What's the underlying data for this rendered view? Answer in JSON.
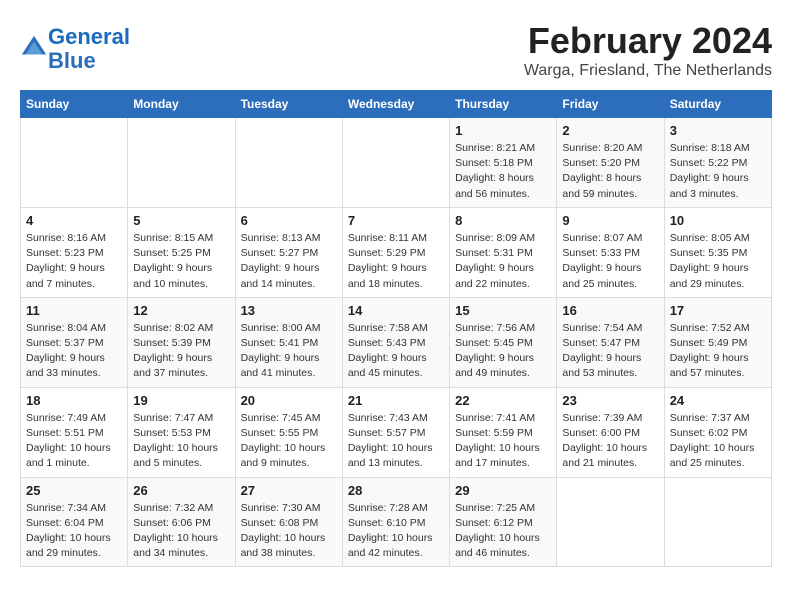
{
  "header": {
    "logo_line1": "General",
    "logo_line2": "Blue",
    "title": "February 2024",
    "subtitle": "Warga, Friesland, The Netherlands"
  },
  "days_of_week": [
    "Sunday",
    "Monday",
    "Tuesday",
    "Wednesday",
    "Thursday",
    "Friday",
    "Saturday"
  ],
  "weeks": [
    [
      {
        "day": "",
        "info": ""
      },
      {
        "day": "",
        "info": ""
      },
      {
        "day": "",
        "info": ""
      },
      {
        "day": "",
        "info": ""
      },
      {
        "day": "1",
        "info": "Sunrise: 8:21 AM\nSunset: 5:18 PM\nDaylight: 8 hours\nand 56 minutes."
      },
      {
        "day": "2",
        "info": "Sunrise: 8:20 AM\nSunset: 5:20 PM\nDaylight: 8 hours\nand 59 minutes."
      },
      {
        "day": "3",
        "info": "Sunrise: 8:18 AM\nSunset: 5:22 PM\nDaylight: 9 hours\nand 3 minutes."
      }
    ],
    [
      {
        "day": "4",
        "info": "Sunrise: 8:16 AM\nSunset: 5:23 PM\nDaylight: 9 hours\nand 7 minutes."
      },
      {
        "day": "5",
        "info": "Sunrise: 8:15 AM\nSunset: 5:25 PM\nDaylight: 9 hours\nand 10 minutes."
      },
      {
        "day": "6",
        "info": "Sunrise: 8:13 AM\nSunset: 5:27 PM\nDaylight: 9 hours\nand 14 minutes."
      },
      {
        "day": "7",
        "info": "Sunrise: 8:11 AM\nSunset: 5:29 PM\nDaylight: 9 hours\nand 18 minutes."
      },
      {
        "day": "8",
        "info": "Sunrise: 8:09 AM\nSunset: 5:31 PM\nDaylight: 9 hours\nand 22 minutes."
      },
      {
        "day": "9",
        "info": "Sunrise: 8:07 AM\nSunset: 5:33 PM\nDaylight: 9 hours\nand 25 minutes."
      },
      {
        "day": "10",
        "info": "Sunrise: 8:05 AM\nSunset: 5:35 PM\nDaylight: 9 hours\nand 29 minutes."
      }
    ],
    [
      {
        "day": "11",
        "info": "Sunrise: 8:04 AM\nSunset: 5:37 PM\nDaylight: 9 hours\nand 33 minutes."
      },
      {
        "day": "12",
        "info": "Sunrise: 8:02 AM\nSunset: 5:39 PM\nDaylight: 9 hours\nand 37 minutes."
      },
      {
        "day": "13",
        "info": "Sunrise: 8:00 AM\nSunset: 5:41 PM\nDaylight: 9 hours\nand 41 minutes."
      },
      {
        "day": "14",
        "info": "Sunrise: 7:58 AM\nSunset: 5:43 PM\nDaylight: 9 hours\nand 45 minutes."
      },
      {
        "day": "15",
        "info": "Sunrise: 7:56 AM\nSunset: 5:45 PM\nDaylight: 9 hours\nand 49 minutes."
      },
      {
        "day": "16",
        "info": "Sunrise: 7:54 AM\nSunset: 5:47 PM\nDaylight: 9 hours\nand 53 minutes."
      },
      {
        "day": "17",
        "info": "Sunrise: 7:52 AM\nSunset: 5:49 PM\nDaylight: 9 hours\nand 57 minutes."
      }
    ],
    [
      {
        "day": "18",
        "info": "Sunrise: 7:49 AM\nSunset: 5:51 PM\nDaylight: 10 hours\nand 1 minute."
      },
      {
        "day": "19",
        "info": "Sunrise: 7:47 AM\nSunset: 5:53 PM\nDaylight: 10 hours\nand 5 minutes."
      },
      {
        "day": "20",
        "info": "Sunrise: 7:45 AM\nSunset: 5:55 PM\nDaylight: 10 hours\nand 9 minutes."
      },
      {
        "day": "21",
        "info": "Sunrise: 7:43 AM\nSunset: 5:57 PM\nDaylight: 10 hours\nand 13 minutes."
      },
      {
        "day": "22",
        "info": "Sunrise: 7:41 AM\nSunset: 5:59 PM\nDaylight: 10 hours\nand 17 minutes."
      },
      {
        "day": "23",
        "info": "Sunrise: 7:39 AM\nSunset: 6:00 PM\nDaylight: 10 hours\nand 21 minutes."
      },
      {
        "day": "24",
        "info": "Sunrise: 7:37 AM\nSunset: 6:02 PM\nDaylight: 10 hours\nand 25 minutes."
      }
    ],
    [
      {
        "day": "25",
        "info": "Sunrise: 7:34 AM\nSunset: 6:04 PM\nDaylight: 10 hours\nand 29 minutes."
      },
      {
        "day": "26",
        "info": "Sunrise: 7:32 AM\nSunset: 6:06 PM\nDaylight: 10 hours\nand 34 minutes."
      },
      {
        "day": "27",
        "info": "Sunrise: 7:30 AM\nSunset: 6:08 PM\nDaylight: 10 hours\nand 38 minutes."
      },
      {
        "day": "28",
        "info": "Sunrise: 7:28 AM\nSunset: 6:10 PM\nDaylight: 10 hours\nand 42 minutes."
      },
      {
        "day": "29",
        "info": "Sunrise: 7:25 AM\nSunset: 6:12 PM\nDaylight: 10 hours\nand 46 minutes."
      },
      {
        "day": "",
        "info": ""
      },
      {
        "day": "",
        "info": ""
      }
    ]
  ]
}
